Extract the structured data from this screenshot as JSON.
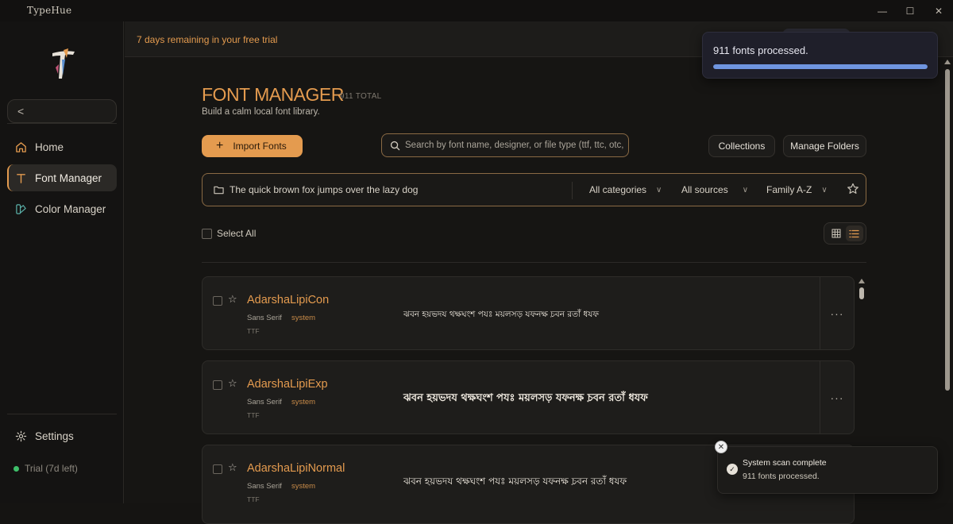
{
  "window": {
    "title": "TypeHue",
    "controls": {
      "minimize": "—",
      "maximize": "☐",
      "close": "✕"
    }
  },
  "sidebar": {
    "collapse_label": "<",
    "items": [
      {
        "label": "Home",
        "icon": "home-icon"
      },
      {
        "label": "Font Manager",
        "icon": "type-icon",
        "active": true
      },
      {
        "label": "Color Manager",
        "icon": "palette-icon"
      }
    ],
    "settings_label": "Settings",
    "trial_label": "Trial (7d left)"
  },
  "banner": {
    "text": "7 days remaining in your free trial"
  },
  "page": {
    "title": "FONT MANAGER",
    "total": "911 TOTAL",
    "subtitle": "Build a calm local font library."
  },
  "toolbar": {
    "import_label": "Import Fonts",
    "search_placeholder": "Search by font name, designer, or file type (ttf, ttc, otc,",
    "collections_label": "Collections",
    "manage_folders_label": "Manage Folders"
  },
  "filters": {
    "preview_text": "The quick brown fox jumps over the lazy dog",
    "category": "All categories",
    "source": "All sources",
    "sort": "Family A-Z"
  },
  "list": {
    "select_all_label": "Select All",
    "fonts": [
      {
        "name": "AdarshaLipiCon",
        "category": "Sans Serif",
        "source": "system",
        "type": "TTF",
        "preview": "ঝবন হয়ভদয থক্ষঘংশ পযঃ ময়লসড় যফনক্ষ চ়বন রতাঁ ধযফ"
      },
      {
        "name": "AdarshaLipiExp",
        "category": "Sans Serif",
        "source": "system",
        "type": "TTF",
        "preview": "ঝবন হয়ভদয থক্ষঘংশ পযঃ ময়লসড় যফনক্ষ চ়বন রতাঁ ধযফ"
      },
      {
        "name": "AdarshaLipiNormal",
        "category": "Sans Serif",
        "source": "system",
        "type": "TTF",
        "preview": "ঝবন হয়ভদয থক্ষঘংশ পযঃ ময়লসড় যফনক্ষ চ়বন রতাঁ ধযফ"
      }
    ],
    "more_label": "···"
  },
  "toasts": {
    "progress": {
      "message": "911 fonts processed.",
      "progress": 1.0
    },
    "scan": {
      "title": "System scan complete",
      "message": "911 fonts processed."
    }
  },
  "colors": {
    "accent": "#e49b4f",
    "progress": "#6f95e0",
    "success": "#3fbf6a"
  }
}
